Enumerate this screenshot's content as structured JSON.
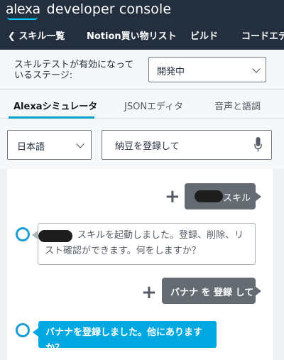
{
  "header": {
    "logo_text": "alexa",
    "title": "developer console",
    "nav": {
      "back_label": "❮ スキル一覧",
      "skill_name": "Notion買い物リスト",
      "build": "ビルド",
      "code_editor": "コードエデ"
    }
  },
  "stage": {
    "label": "スキルテストが有効になっているステージ:",
    "value": "開発中"
  },
  "tabs": [
    "Alexaシミュレータ",
    "JSONエディタ",
    "音声と語調"
  ],
  "language": {
    "value": "日本語"
  },
  "utterance": {
    "value": "納豆を登録して"
  },
  "chat": {
    "user_1": "スキル",
    "alexa_1": "スキルを起動しました。登録、削除、リスト確認ができます。何をしますか？",
    "user_2": "バナナ を 登録 して",
    "alexa_2": "バナナを登録しました。他にありますか？"
  },
  "colors": {
    "header_bg": "#232f3e",
    "accent": "#00a1c9",
    "alexa_blue": "#00a8e1",
    "user_bubble": "#646b73"
  }
}
